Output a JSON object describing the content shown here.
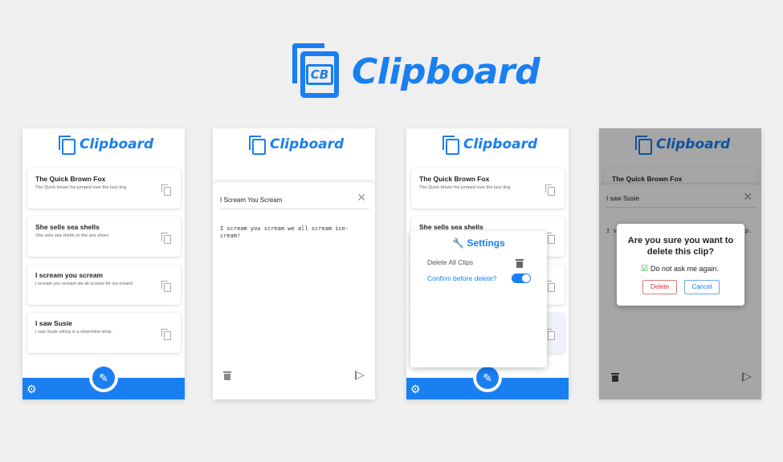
{
  "hero": {
    "logo_letters": "CB",
    "title": "Clipboard"
  },
  "app_title": "Clipboard",
  "clips": [
    {
      "title": "The Quick Brown Fox",
      "text": "The Quick brown fox jumped over the lazy dog"
    },
    {
      "title": "She sells sea shells",
      "text": "She sells sea shells on the sea shore."
    },
    {
      "title": "I scream you scream",
      "text": "I scream you scream we all scream for ice-cream!"
    },
    {
      "title": "I saw Susie",
      "text": "I saw Susie sitting in a shoeshine shop."
    }
  ],
  "editor": {
    "title": "I Scream You Scream",
    "body": "I scream you scream we all scream ice-cream!"
  },
  "settings": {
    "title": "Settings",
    "delete_all": "Delete All Clips",
    "confirm_delete": "Confirm before delete?",
    "confirm_delete_enabled": true
  },
  "delete_dialog": {
    "editor_title": "I saw Susie",
    "editor_body_fragment_left": "I s",
    "editor_body_fragment_right": "p.",
    "question": "Are you sure you want to delete this clip?",
    "checkbox_label": "Do not ask me again.",
    "checkbox_checked": true,
    "delete_label": "Delete",
    "cancel_label": "Cancel"
  },
  "icons": {
    "copy": "copy-icon",
    "settings": "gear-icon",
    "edit": "pencil-icon",
    "trash": "trash-icon",
    "send": "send-icon",
    "close": "close-icon",
    "wrench": "wrench-icon"
  },
  "colors": {
    "brand": "#1a7ff0",
    "danger": "#d33333",
    "check": "#2c9a3a",
    "background": "#efefef"
  }
}
